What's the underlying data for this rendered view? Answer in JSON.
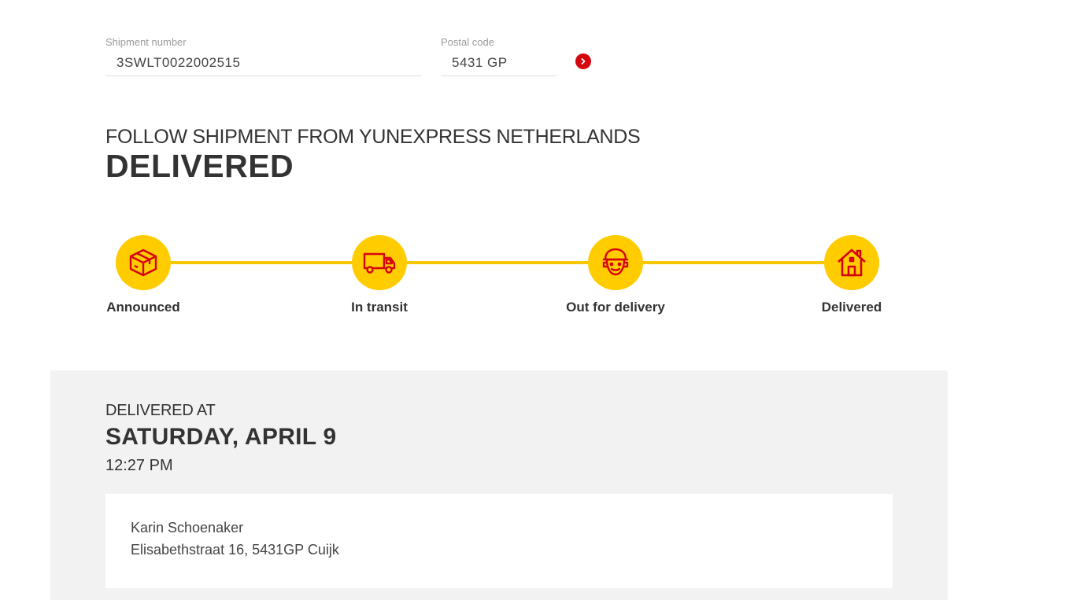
{
  "search": {
    "shipment_label": "Shipment number",
    "shipment_value": "3SWLT0022002515",
    "postal_label": "Postal code",
    "postal_value": "5431 GP",
    "submit_icon": "chevron-right-icon"
  },
  "header": {
    "subtitle": "FOLLOW SHIPMENT FROM YUNEXPRESS NETHERLANDS",
    "status": "DELIVERED"
  },
  "progress": {
    "steps": [
      {
        "label": "Announced",
        "icon": "package-icon"
      },
      {
        "label": "In transit",
        "icon": "truck-icon"
      },
      {
        "label": "Out for delivery",
        "icon": "courier-icon"
      },
      {
        "label": "Delivered",
        "icon": "house-icon"
      }
    ],
    "colors": {
      "line": "#f6c800",
      "circle": "#ffcc00",
      "icon": "#d40511"
    }
  },
  "delivery": {
    "heading": "DELIVERED AT",
    "date": "SATURDAY, APRIL 9",
    "time": "12:27 PM",
    "recipient_name": "Karin Schoenaker",
    "recipient_address": "Elisabethstraat 16, 5431GP Cuijk"
  },
  "colors": {
    "accent_red": "#d40511",
    "accent_yellow": "#ffcc00",
    "panel_bg": "#f2f2f2"
  }
}
